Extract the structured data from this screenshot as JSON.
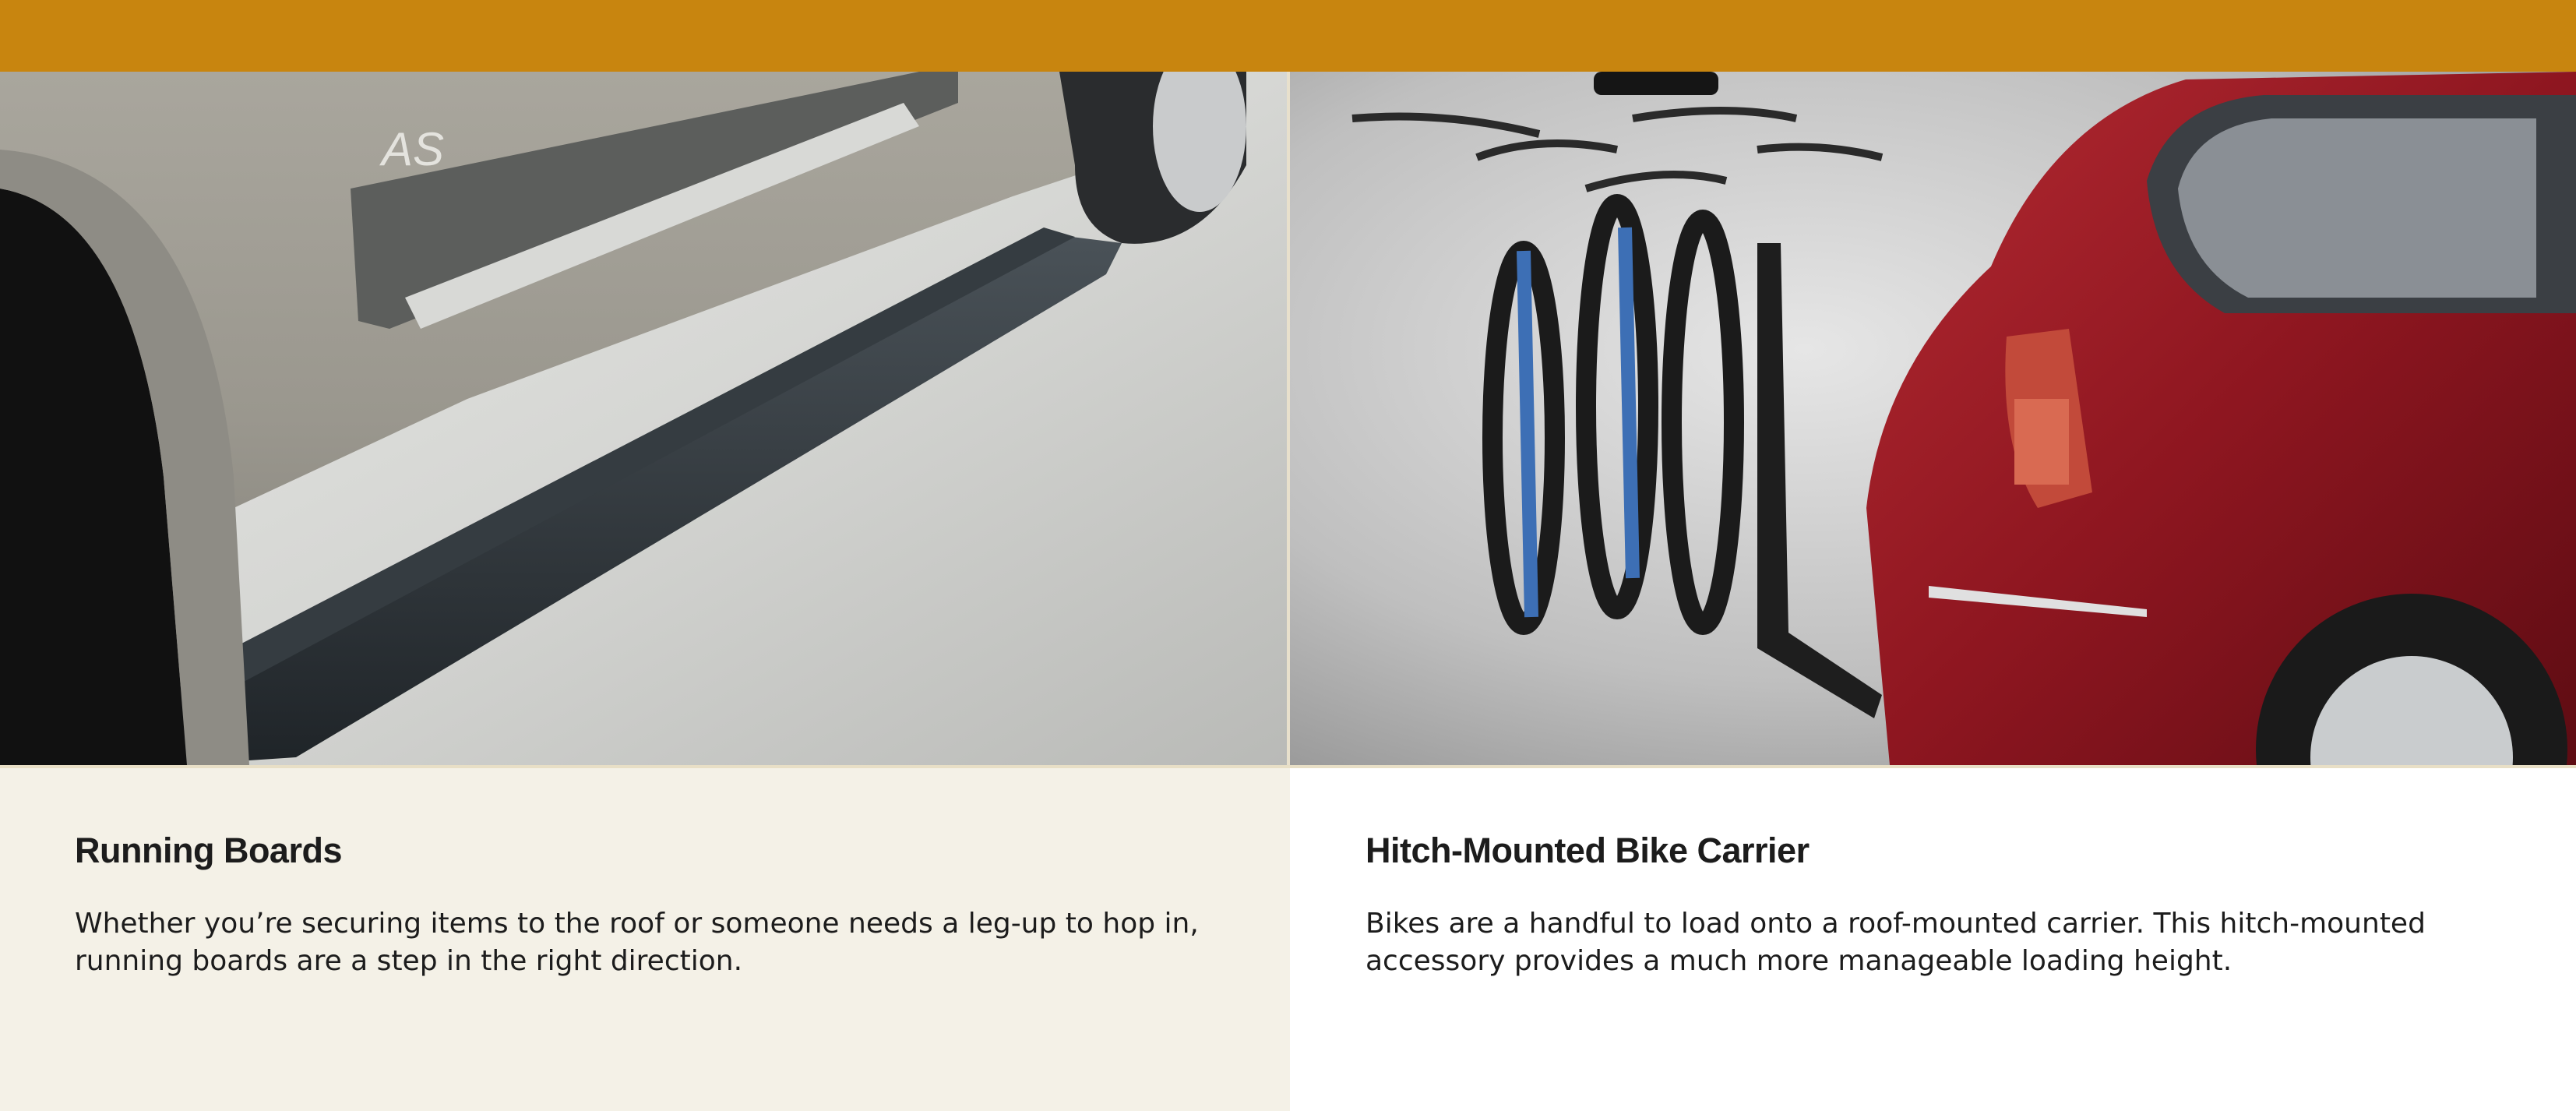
{
  "colors": {
    "top_bar": "#c8850f",
    "left_panel_bg": "#f4f1e7",
    "right_panel_bg": "#ffffff",
    "text": "#1c1c1c"
  },
  "features": [
    {
      "title": "Running Boards",
      "description": "Whether you’re securing items to the roof or someone needs a leg-up to hop in, running boards are a step in the right direction."
    },
    {
      "title": "Hitch-Mounted Bike Carrier",
      "description": "Bikes are a handful to load onto a roof-mounted carrier. This hitch-mounted accessory provides a much more manageable loading height."
    }
  ]
}
